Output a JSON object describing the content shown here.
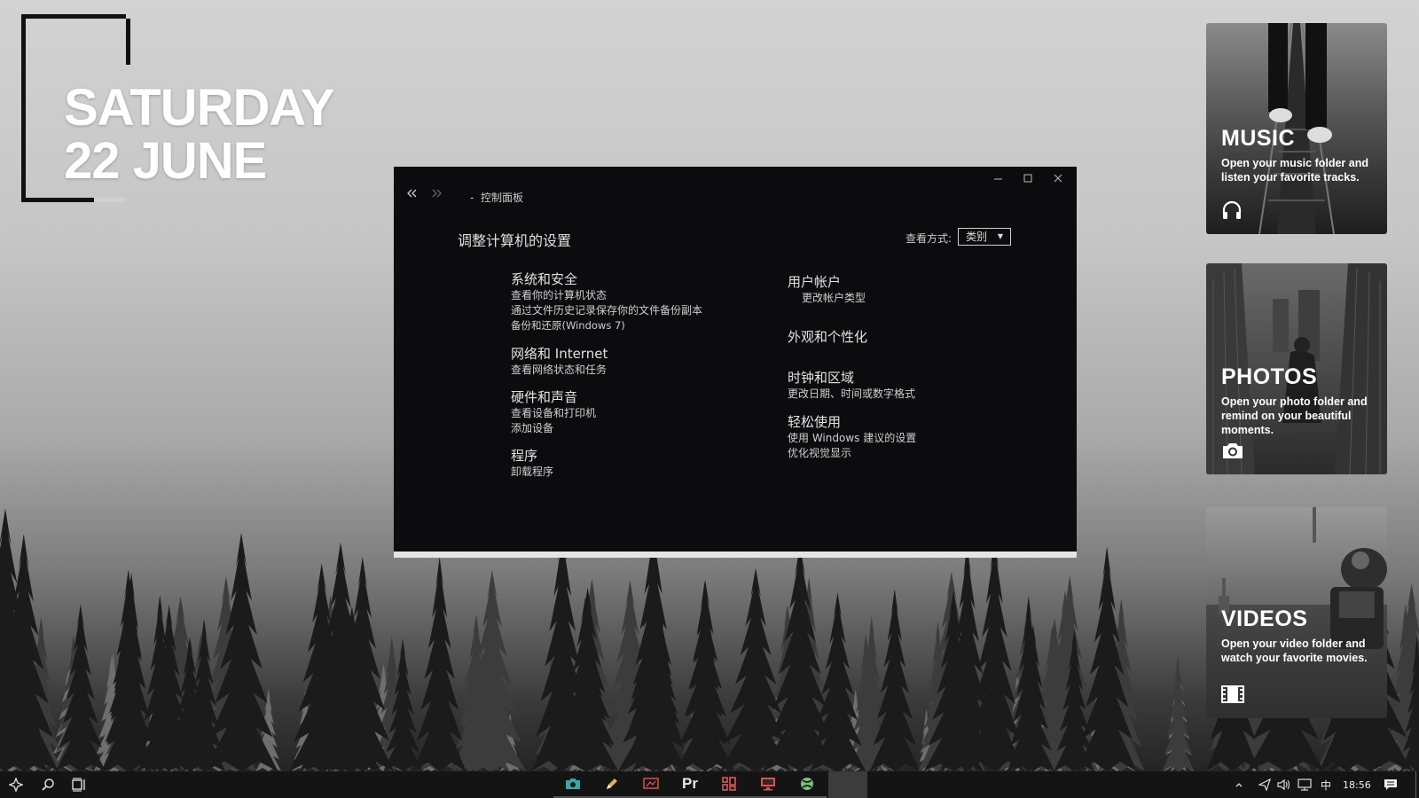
{
  "date_widget": {
    "line1": "SATURDAY",
    "line2": "22 JUNE"
  },
  "control_panel": {
    "breadcrumb": "控制面板",
    "breadcrumb_sep": "-",
    "heading": "调整计算机的设置",
    "view_by_label": "查看方式:",
    "view_by_value": "类别",
    "left_categories": [
      {
        "title": "系统和安全",
        "links": [
          "查看你的计算机状态",
          "通过文件历史记录保存你的文件备份副本",
          "备份和还原(Windows 7)"
        ]
      },
      {
        "title": "网络和 Internet",
        "links": [
          "查看网络状态和任务"
        ]
      },
      {
        "title": "硬件和声音",
        "links": [
          "查看设备和打印机",
          "添加设备"
        ]
      },
      {
        "title": "程序",
        "links": [
          "卸载程序"
        ]
      }
    ],
    "right_categories": [
      {
        "title": "用户帐户",
        "links": [
          "更改帐户类型"
        ]
      },
      {
        "title": "外观和个性化",
        "links": []
      },
      {
        "title": "时钟和区域",
        "links": [
          "更改日期、时间或数字格式"
        ]
      },
      {
        "title": "轻松使用",
        "links": [
          "使用 Windows 建议的设置",
          "优化视觉显示"
        ]
      }
    ]
  },
  "tiles": {
    "music": {
      "title": "MUSIC",
      "desc": "Open your music folder and listen your favorite tracks.",
      "icon": "headphones-icon"
    },
    "photos": {
      "title": "PHOTOS",
      "desc": "Open your photo folder and remind on your beautiful moments.",
      "icon": "camera-icon"
    },
    "videos": {
      "title": "VIDEOS",
      "desc": "Open your video folder and watch your favorite movies.",
      "icon": "film-icon"
    }
  },
  "taskbar": {
    "clock": "18:56",
    "ime": "中",
    "apps": [
      "camera-app",
      "pen-app",
      "presentation-app",
      "premiere-app",
      "layout-app",
      "monitor-app",
      "xbox-app",
      "active-app"
    ],
    "premiere_label": "Pr"
  }
}
